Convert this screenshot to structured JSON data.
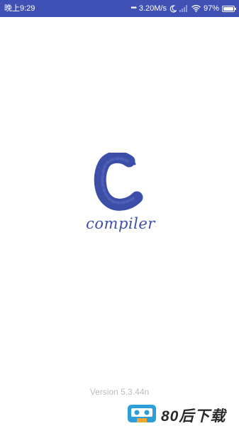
{
  "status_bar": {
    "time": "晚上9:29",
    "network_speed": "3.20M/s",
    "battery_percent_text": "97%",
    "battery_level": 0.97,
    "background_color": "#3f51b5",
    "icons": [
      "dots-icon",
      "moon-icon",
      "signal-icon",
      "wifi-icon",
      "battery-icon"
    ]
  },
  "splash": {
    "logo_letter_icon": "c-logo-icon",
    "app_name": "compiler",
    "brand_color": "#3c4fa8",
    "version": "Version 5.3.44n"
  },
  "watermark": {
    "text": "80后下载",
    "icon": "cassette-icon"
  }
}
